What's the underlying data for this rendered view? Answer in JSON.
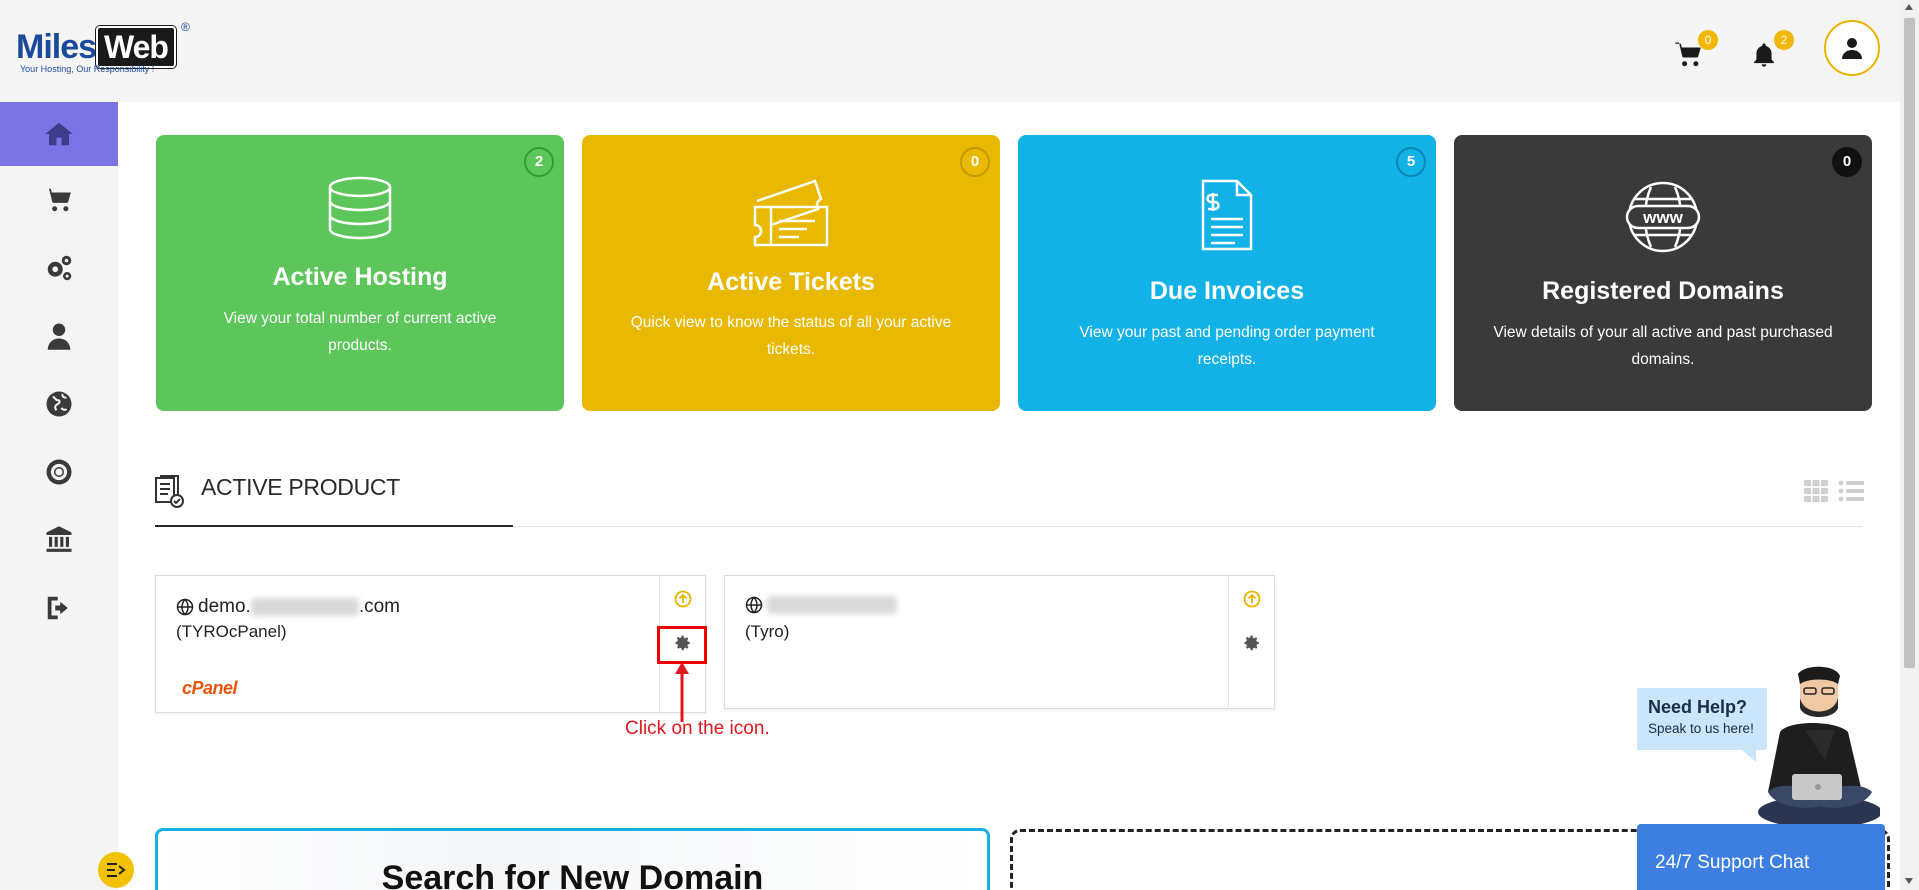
{
  "brand": {
    "name_part1": "Miles",
    "name_part2": "Web",
    "registered_mark": "®",
    "tagline": "Your Hosting, Our Responsibility !"
  },
  "header": {
    "cart_count": "0",
    "notifications_count": "2"
  },
  "sidebar": {
    "items": [
      {
        "icon": "home-icon",
        "active": true
      },
      {
        "icon": "cart-icon"
      },
      {
        "icon": "gears-icon"
      },
      {
        "icon": "user-icon"
      },
      {
        "icon": "globe-icon"
      },
      {
        "icon": "lifebuoy-icon"
      },
      {
        "icon": "bank-icon"
      },
      {
        "icon": "logout-icon"
      }
    ]
  },
  "stats": [
    {
      "title": "Active Hosting",
      "count": "2",
      "description": "View your total number of current active products.",
      "color": "#5cc65a",
      "badge_color": "#2ea02c"
    },
    {
      "title": "Active Tickets",
      "count": "0",
      "description": "Quick view to know the  status of all your active tickets.",
      "color": "#e9b800",
      "badge_color": "#c29a00"
    },
    {
      "title": "Due Invoices",
      "count": "5",
      "description": "View your past and pending order payment receipts.",
      "color": "#12b1e6",
      "badge_color": "#0a87b2"
    },
    {
      "title": "Registered Domains",
      "count": "0",
      "description": "View details of your all active and past purchased domains.",
      "color": "#3a3a3a",
      "badge_color": "#111111"
    }
  ],
  "active_product": {
    "section_title": "ACTIVE PRODUCT",
    "products": [
      {
        "domain_prefix": "demo.",
        "domain_suffix": ".com",
        "plan": "(TYROcPanel)",
        "panel_logo": "cPanel"
      },
      {
        "domain_prefix": "",
        "domain_suffix": "",
        "plan": "(Tyro)",
        "panel_logo": ""
      }
    ]
  },
  "annotation": {
    "text": "Click on the icon."
  },
  "search": {
    "title": "Search for New Domain"
  },
  "help": {
    "title": "Need Help?",
    "subtitle": "Speak to us here!",
    "support_button": "24/7 Support Chat"
  }
}
